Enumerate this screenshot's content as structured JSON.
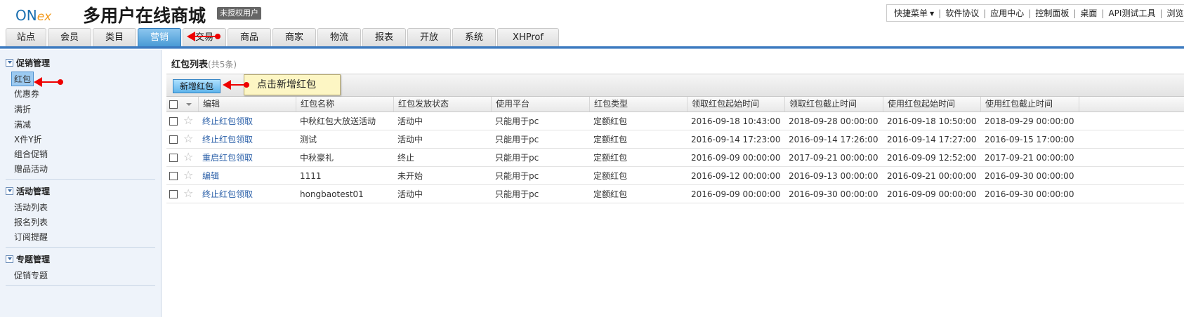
{
  "header": {
    "logo": "ONex",
    "title": "多用户在线商城",
    "badge": "未授权用户",
    "quick_menu": "快捷菜单",
    "links": [
      "软件协议",
      "应用中心",
      "控制面板",
      "桌面",
      "API测试工具",
      "浏览商"
    ]
  },
  "tabs": [
    {
      "label": "站点",
      "w": 58
    },
    {
      "label": "会员",
      "w": 62
    },
    {
      "label": "类目",
      "w": 62
    },
    {
      "label": "营销",
      "w": 62,
      "active": true
    },
    {
      "label": "交易",
      "w": 62
    },
    {
      "label": "商品",
      "w": 62
    },
    {
      "label": "商家",
      "w": 62
    },
    {
      "label": "物流",
      "w": 62
    },
    {
      "label": "报表",
      "w": 62
    },
    {
      "label": "开放",
      "w": 62
    },
    {
      "label": "系统",
      "w": 62
    },
    {
      "label": "XHProf",
      "w": 88
    }
  ],
  "sidebar": {
    "groups": [
      {
        "title": "促销管理",
        "items": [
          "红包",
          "优惠券",
          "满折",
          "满减",
          "X件Y折",
          "组合促销",
          "赠品活动"
        ]
      },
      {
        "title": "活动管理",
        "items": [
          "活动列表",
          "报名列表",
          "订阅提醒"
        ]
      },
      {
        "title": "专题管理",
        "items": [
          "促销专题"
        ]
      }
    ]
  },
  "main": {
    "list_title": "红包列表",
    "list_count": "(共5条)",
    "add_button": "新增红包",
    "callout": "点击新增红包"
  },
  "table": {
    "columns": [
      "编辑",
      "红包名称",
      "红包发放状态",
      "使用平台",
      "红包类型",
      "领取红包起始时间",
      "领取红包截止时间",
      "使用红包起始时间",
      "使用红包截止时间"
    ],
    "rows": [
      [
        "终止红包领取",
        "中秋红包大放送活动",
        "活动中",
        "只能用于pc",
        "定额红包",
        "2016-09-18 10:43:00",
        "2018-09-28 00:00:00",
        "2016-09-18 10:50:00",
        "2018-09-29 00:00:00"
      ],
      [
        "终止红包领取",
        "测试",
        "活动中",
        "只能用于pc",
        "定额红包",
        "2016-09-14 17:23:00",
        "2016-09-14 17:26:00",
        "2016-09-14 17:27:00",
        "2016-09-15 17:00:00"
      ],
      [
        "重启红包领取",
        "中秋豪礼",
        "终止",
        "只能用于pc",
        "定额红包",
        "2016-09-09 00:00:00",
        "2017-09-21 00:00:00",
        "2016-09-09 12:52:00",
        "2017-09-21 00:00:00"
      ],
      [
        "编辑",
        "1111",
        "未开始",
        "只能用于pc",
        "定额红包",
        "2016-09-12 00:00:00",
        "2016-09-13 00:00:00",
        "2016-09-21 00:00:00",
        "2016-09-30 00:00:00"
      ],
      [
        "终止红包领取",
        "hongbaotest01",
        "活动中",
        "只能用于pc",
        "定额红包",
        "2016-09-09 00:00:00",
        "2016-09-30 00:00:00",
        "2016-09-09 00:00:00",
        "2016-09-30 00:00:00"
      ]
    ]
  },
  "colors": {
    "accent": "#3c7ac0",
    "active_tab": "#4a9bd6",
    "link": "#2a5fa8",
    "annotation": "#e00000",
    "callout_bg": "#fdf6c4"
  }
}
